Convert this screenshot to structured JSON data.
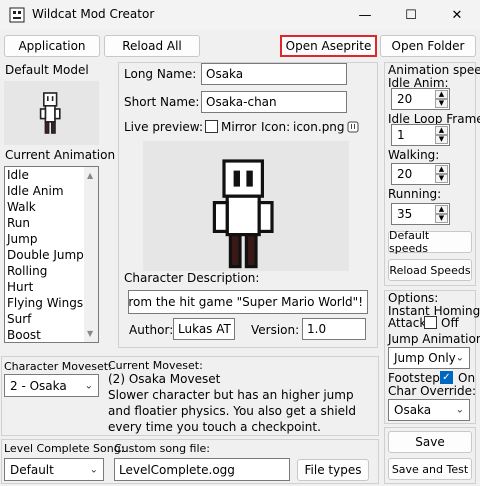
{
  "window": {
    "title": "Wildcat Mod Creator",
    "minimize_glyph": "—",
    "maximize_glyph": "☐",
    "close_glyph": "✕"
  },
  "toolbar": {
    "application": "Application",
    "reload_all": "Reload All",
    "open_aseprite": "Open Aseprite",
    "open_folder": "Open Folder"
  },
  "left": {
    "default_model": "Default Model",
    "current_animation": "Current Animation",
    "animations": [
      "Idle",
      "Idle Anim",
      "Walk",
      "Run",
      "Jump",
      "Double Jump",
      "Rolling",
      "Hurt",
      "Flying Wings",
      "Surf",
      "Boost"
    ]
  },
  "center": {
    "long_name_label": "Long Name:",
    "long_name_value": "Osaka",
    "short_name_label": "Short Name:",
    "short_name_value": "Osaka-chan",
    "live_preview_label": "Live preview:",
    "mirror_label": "Mirror",
    "icon_label": "Icon:",
    "icon_file": "icon.png",
    "char_desc_label": "Character Description:",
    "char_desc_value": "from the hit game \"Super Mario World\"!",
    "author_label": "Author:",
    "author_value": "Lukas AT",
    "version_label": "Version:",
    "version_value": "1.0"
  },
  "speeds": {
    "header": "Animation speeds:",
    "idle_anim_label": "Idle Anim:",
    "idle_anim_value": "20",
    "idle_loop_label": "Idle Loop Frame:",
    "idle_loop_value": "1",
    "walking_label": "Walking:",
    "walking_value": "20",
    "running_label": "Running:",
    "running_value": "35",
    "default_speeds": "Default speeds",
    "reload_speeds": "Reload Speeds"
  },
  "options": {
    "header": "Options:",
    "instant_homing_label": "Instant Homing",
    "attack_label": "Attack:",
    "attack_state": "Off",
    "jump_anim_label": "Jump Animation:",
    "jump_anim_value": "Jump Only",
    "footsteps_label": "Footsteps:",
    "footsteps_state": "On",
    "char_override_label": "Char Override:",
    "char_override_value": "Osaka"
  },
  "moveset": {
    "label": "Character Moveset:",
    "value": "2 - Osaka",
    "current_label": "Current Moveset:",
    "title": "(2) Osaka Moveset",
    "description_lines": [
      "Slower character but has an higher jump",
      "and floatier physics. You also get a shield",
      "every time you touch a checkpoint."
    ]
  },
  "song": {
    "label": "Level Complete Song:",
    "value": "Default",
    "custom_label": "Custom song file:",
    "custom_value": "LevelComplete.ogg",
    "file_types": "File types"
  },
  "actions": {
    "save": "Save",
    "save_and_test": "Save and Test"
  }
}
